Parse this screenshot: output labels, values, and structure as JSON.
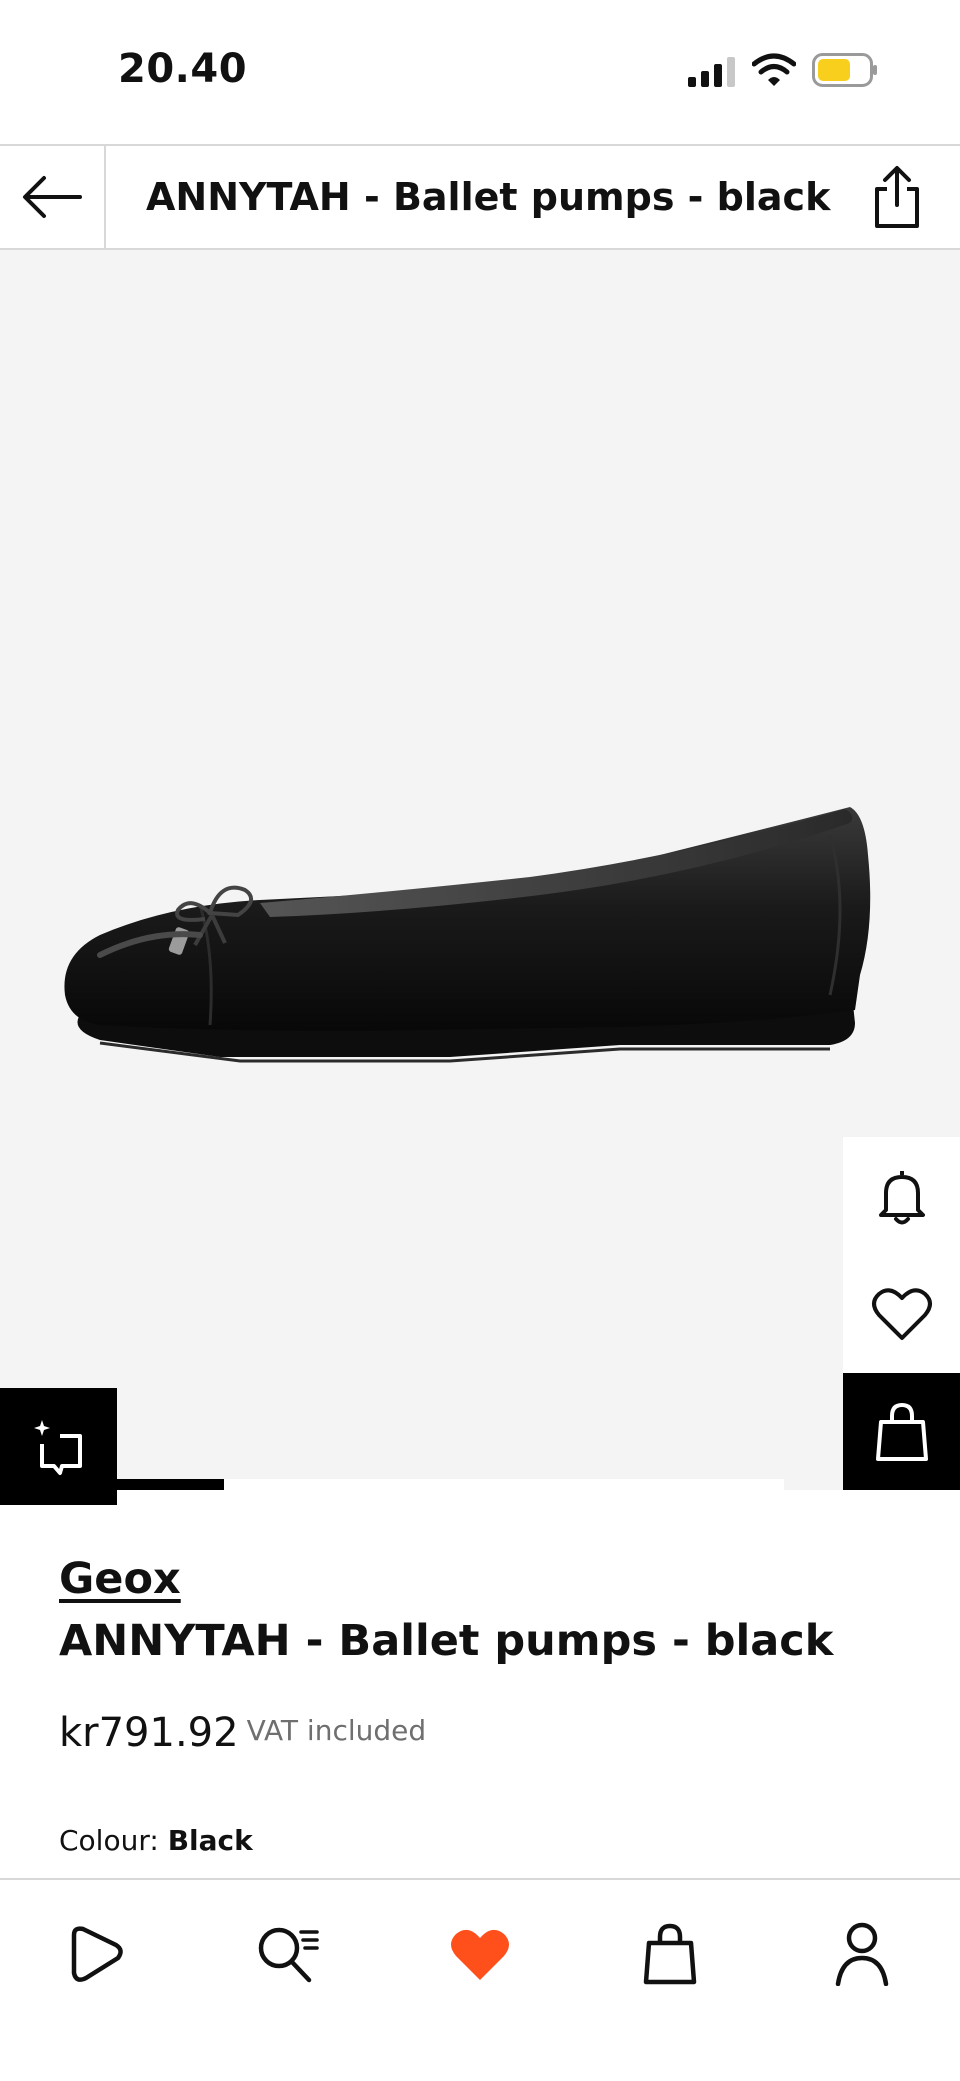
{
  "status_bar": {
    "time": "20.40",
    "battery_color": "#F9CF1E"
  },
  "header": {
    "title": "ANNYTAH - Ballet pumps - black",
    "back_icon": "arrow-left-icon",
    "share_icon": "share-icon"
  },
  "gallery": {
    "background_color": "#F4F4F4",
    "image_subject": "black leather ballet pump",
    "side_actions": [
      {
        "name": "notify",
        "icon": "bell-icon"
      },
      {
        "name": "wishlist",
        "icon": "heart-icon"
      },
      {
        "name": "add-to-bag",
        "icon": "bag-icon"
      }
    ],
    "similar_icon": "sparkle-crop-icon",
    "carousel_position": 0.16
  },
  "product": {
    "brand": "Geox",
    "name": "ANNYTAH - Ballet pumps - black",
    "price": "kr791.92",
    "vat_note": "VAT included",
    "colour_label": "Colour: ",
    "colour_value": "Black"
  },
  "bottom_nav": {
    "items": [
      {
        "name": "home",
        "icon": "play-logo-icon"
      },
      {
        "name": "search",
        "icon": "search-list-icon"
      },
      {
        "name": "wishlist",
        "icon": "heart-filled-icon",
        "color": "#FF4F1A"
      },
      {
        "name": "bag",
        "icon": "bag-icon"
      },
      {
        "name": "account",
        "icon": "person-icon"
      }
    ]
  }
}
